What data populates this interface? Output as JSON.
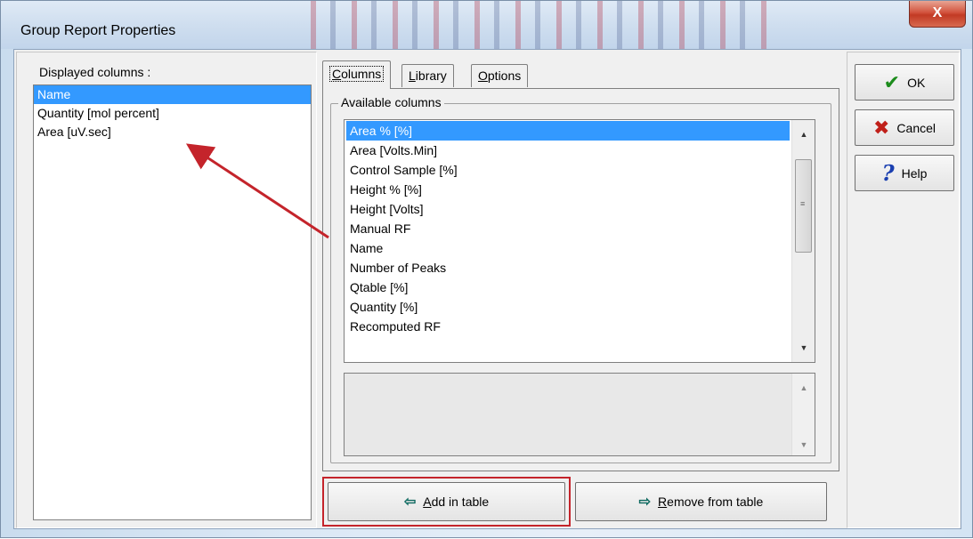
{
  "window": {
    "title": "Group Report Properties",
    "close_label": "X"
  },
  "left": {
    "label": "Displayed columns :",
    "items": [
      "Name",
      "Quantity [mol percent]",
      "Area [uV.sec]"
    ],
    "selected_index": 0
  },
  "tabs": [
    {
      "label": "Columns",
      "underline_char": "C",
      "active": true
    },
    {
      "label": "Library",
      "underline_char": "L",
      "active": false
    },
    {
      "label": "Options",
      "underline_char": "O",
      "active": false
    }
  ],
  "columns_tab": {
    "group_label": "Available columns",
    "available": [
      "Area % [%]",
      "Area [Volts.Min]",
      "Control Sample [%]",
      "Height % [%]",
      "Height [Volts]",
      "Manual RF",
      "Name",
      "Number of Peaks",
      "Qtable [%]",
      "Quantity [%]",
      "Recomputed RF"
    ],
    "selected_index": 0
  },
  "buttons": {
    "add_label": "Add in table",
    "add_underline": "A",
    "remove_label": "Remove from table",
    "remove_underline": "R",
    "ok_label": "OK",
    "cancel_label": "Cancel",
    "help_label": "Help"
  },
  "icons": {
    "ok": "checkmark-icon",
    "cancel": "red-x-icon",
    "help": "question-mark-icon",
    "add": "arrow-left-icon",
    "remove": "arrow-right-icon"
  },
  "colors": {
    "selection": "#3399ff",
    "annotation": "#c4242b"
  }
}
